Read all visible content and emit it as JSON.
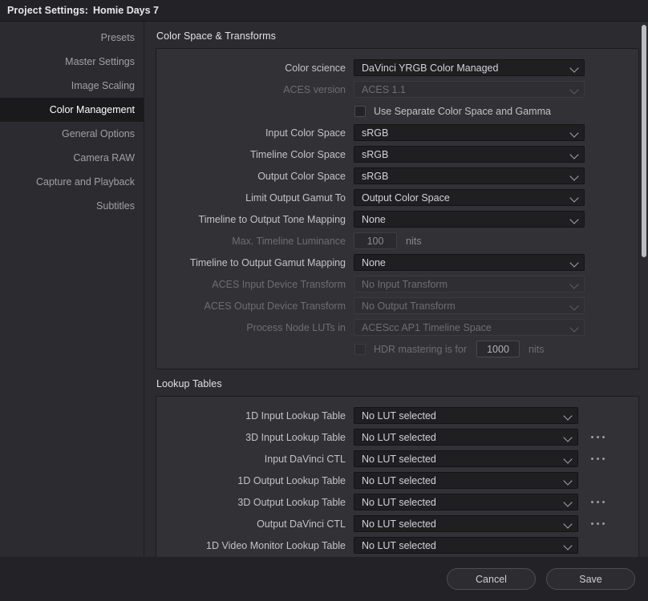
{
  "titlebar": {
    "label": "Project Settings:",
    "project_name": "Homie Days 7"
  },
  "sidebar": {
    "items": [
      {
        "label": "Presets",
        "selected": false
      },
      {
        "label": "Master Settings",
        "selected": false
      },
      {
        "label": "Image Scaling",
        "selected": false
      },
      {
        "label": "Color Management",
        "selected": true
      },
      {
        "label": "General Options",
        "selected": false
      },
      {
        "label": "Camera RAW",
        "selected": false
      },
      {
        "label": "Capture and Playback",
        "selected": false
      },
      {
        "label": "Subtitles",
        "selected": false
      }
    ]
  },
  "sections": [
    {
      "title": "Color Space & Transforms",
      "rows": [
        {
          "kind": "dropdown",
          "label": "Color science",
          "value": "DaVinci YRGB Color Managed",
          "disabled": false
        },
        {
          "kind": "dropdown",
          "label": "ACES version",
          "value": "ACES 1.1",
          "disabled": true
        },
        {
          "kind": "checkbox",
          "label": "Use Separate Color Space and Gamma",
          "checked": false,
          "disabled": false
        },
        {
          "kind": "dropdown",
          "label": "Input Color Space",
          "value": "sRGB",
          "disabled": false
        },
        {
          "kind": "dropdown",
          "label": "Timeline Color Space",
          "value": "sRGB",
          "disabled": false
        },
        {
          "kind": "dropdown",
          "label": "Output Color Space",
          "value": "sRGB",
          "disabled": false
        },
        {
          "kind": "dropdown",
          "label": "Limit Output Gamut To",
          "value": "Output Color Space",
          "disabled": false
        },
        {
          "kind": "dropdown",
          "label": "Timeline to Output Tone Mapping",
          "value": "None",
          "disabled": false
        },
        {
          "kind": "number",
          "label": "Max. Timeline Luminance",
          "value": "100",
          "unit": "nits",
          "disabled": true
        },
        {
          "kind": "dropdown",
          "label": "Timeline to Output Gamut Mapping",
          "value": "None",
          "disabled": false
        },
        {
          "kind": "dropdown",
          "label": "ACES Input Device Transform",
          "value": "No Input Transform",
          "disabled": true
        },
        {
          "kind": "dropdown",
          "label": "ACES Output Device Transform",
          "value": "No Output Transform",
          "disabled": true
        },
        {
          "kind": "dropdown",
          "label": "Process Node LUTs in",
          "value": "ACEScc AP1 Timeline Space",
          "disabled": true
        },
        {
          "kind": "checknumber",
          "label": "HDR mastering is for",
          "checked": false,
          "value": "1000",
          "unit": "nits",
          "disabled": true
        }
      ]
    },
    {
      "title": "Lookup Tables",
      "rows": [
        {
          "kind": "lut",
          "label": "1D Input Lookup Table",
          "value": "No LUT selected",
          "browse": false
        },
        {
          "kind": "lut",
          "label": "3D Input Lookup Table",
          "value": "No LUT selected",
          "browse": true
        },
        {
          "kind": "lut",
          "label": "Input DaVinci CTL",
          "value": "No LUT selected",
          "browse": true
        },
        {
          "kind": "lut",
          "label": "1D Output Lookup Table",
          "value": "No LUT selected",
          "browse": false
        },
        {
          "kind": "lut",
          "label": "3D Output Lookup Table",
          "value": "No LUT selected",
          "browse": true
        },
        {
          "kind": "lut",
          "label": "Output DaVinci CTL",
          "value": "No LUT selected",
          "browse": true
        },
        {
          "kind": "lut",
          "label": "1D Video Monitor Lookup Table",
          "value": "No LUT selected",
          "browse": false
        }
      ]
    }
  ],
  "footer": {
    "cancel_label": "Cancel",
    "save_label": "Save"
  }
}
